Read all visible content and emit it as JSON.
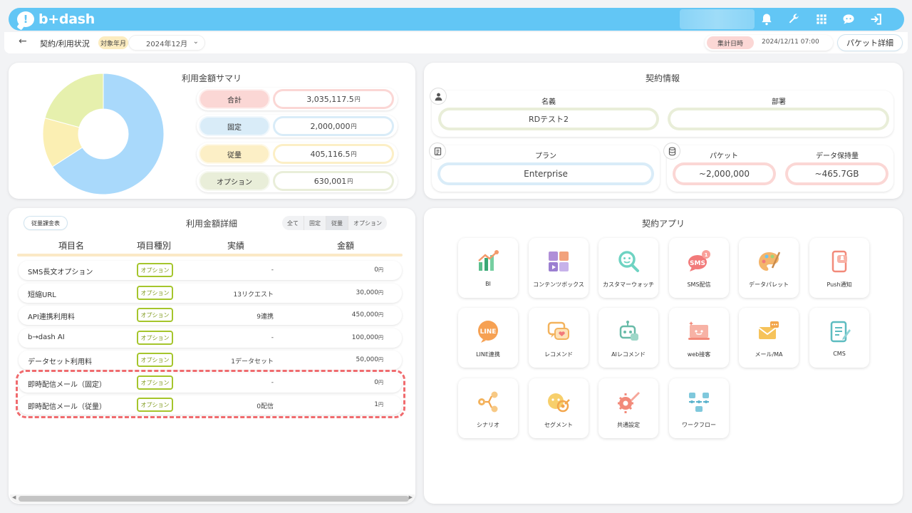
{
  "header": {
    "logo_text": "b+dash",
    "logo_mark": "!"
  },
  "subheader": {
    "back_label": "←",
    "breadcrumb": "契約/利用状況",
    "target_month_label": "対象年月",
    "target_month_value": "2024年12月",
    "aggregate_label": "集計日時",
    "aggregate_value": "2024/12/11 07:00",
    "packet_detail_button": "パケット詳細"
  },
  "summary": {
    "title": "利用金額サマリ",
    "rows": [
      {
        "label": "合計",
        "value": "3,035,117.5",
        "unit": "円",
        "color": "#fbd7d5"
      },
      {
        "label": "固定",
        "value": "2,000,000",
        "unit": "円",
        "color": "#d9ecf8"
      },
      {
        "label": "従量",
        "value": "405,116.5",
        "unit": "円",
        "color": "#fcefc6"
      },
      {
        "label": "オプション",
        "value": "630,001",
        "unit": "円",
        "color": "#e9eed9"
      }
    ],
    "donut": [
      {
        "name": "固定",
        "value": 2000000,
        "color": "#a9d9fb"
      },
      {
        "name": "従量",
        "value": 405116.5,
        "color": "#fbefb3"
      },
      {
        "name": "オプション",
        "value": 630001,
        "color": "#e6f0ad"
      }
    ]
  },
  "contract": {
    "title": "契約情報",
    "name_label": "名義",
    "name_value": "RDテスト2",
    "dept_label": "部署",
    "dept_value": "",
    "plan_label": "プラン",
    "plan_value": "Enterprise",
    "packet_label": "パケット",
    "packet_value": "~2,000,000",
    "storage_label": "データ保持量",
    "storage_value": "~465.7GB"
  },
  "detail": {
    "title": "利用金額詳細",
    "usage_button": "従量課金表",
    "filters": [
      "全て",
      "固定",
      "従量",
      "オプション"
    ],
    "columns": [
      "項目名",
      "項目種別",
      "実績",
      "金額"
    ],
    "rows": [
      {
        "name": "SMS長文オプション",
        "type": "オプション",
        "actual": "-",
        "amount": "0",
        "unit": "円"
      },
      {
        "name": "短縮URL",
        "type": "オプション",
        "actual": "13リクエスト",
        "amount": "30,000",
        "unit": "円"
      },
      {
        "name": "API連携利用料",
        "type": "オプション",
        "actual": "9連携",
        "amount": "450,000",
        "unit": "円"
      },
      {
        "name": "b→dash AI",
        "type": "オプション",
        "actual": "-",
        "amount": "100,000",
        "unit": "円"
      },
      {
        "name": "データセット利用料",
        "type": "オプション",
        "actual": "1データセット",
        "amount": "50,000",
        "unit": "円"
      },
      {
        "name": "即時配信メール（固定）",
        "type": "オプション",
        "actual": "-",
        "amount": "0",
        "unit": "円"
      },
      {
        "name": "即時配信メール（従量）",
        "type": "オプション",
        "actual": "0配信",
        "amount": "1",
        "unit": "円"
      }
    ]
  },
  "apps": {
    "title": "契約アプリ",
    "items": [
      {
        "label": "BI",
        "icon": "bi-icon"
      },
      {
        "label": "コンテンツボックス",
        "icon": "content-box-icon"
      },
      {
        "label": "カスタマーウォッチ",
        "icon": "customer-watch-icon"
      },
      {
        "label": "SMS配信",
        "icon": "sms-icon",
        "badge": "1"
      },
      {
        "label": "データパレット",
        "icon": "data-palette-icon"
      },
      {
        "label": "Push通知",
        "icon": "push-icon"
      },
      {
        "label": "LINE連携",
        "icon": "line-icon",
        "text": "LINE"
      },
      {
        "label": "レコメンド",
        "icon": "recommend-icon"
      },
      {
        "label": "AIレコメンド",
        "icon": "ai-recommend-icon"
      },
      {
        "label": "web接客",
        "icon": "web-service-icon"
      },
      {
        "label": "メール/MA",
        "icon": "mail-icon"
      },
      {
        "label": "CMS",
        "icon": "cms-icon"
      },
      {
        "label": "シナリオ",
        "icon": "scenario-icon"
      },
      {
        "label": "セグメント",
        "icon": "segment-icon"
      },
      {
        "label": "共通設定",
        "icon": "settings-icon"
      },
      {
        "label": "ワークフロー",
        "icon": "workflow-icon"
      }
    ]
  }
}
